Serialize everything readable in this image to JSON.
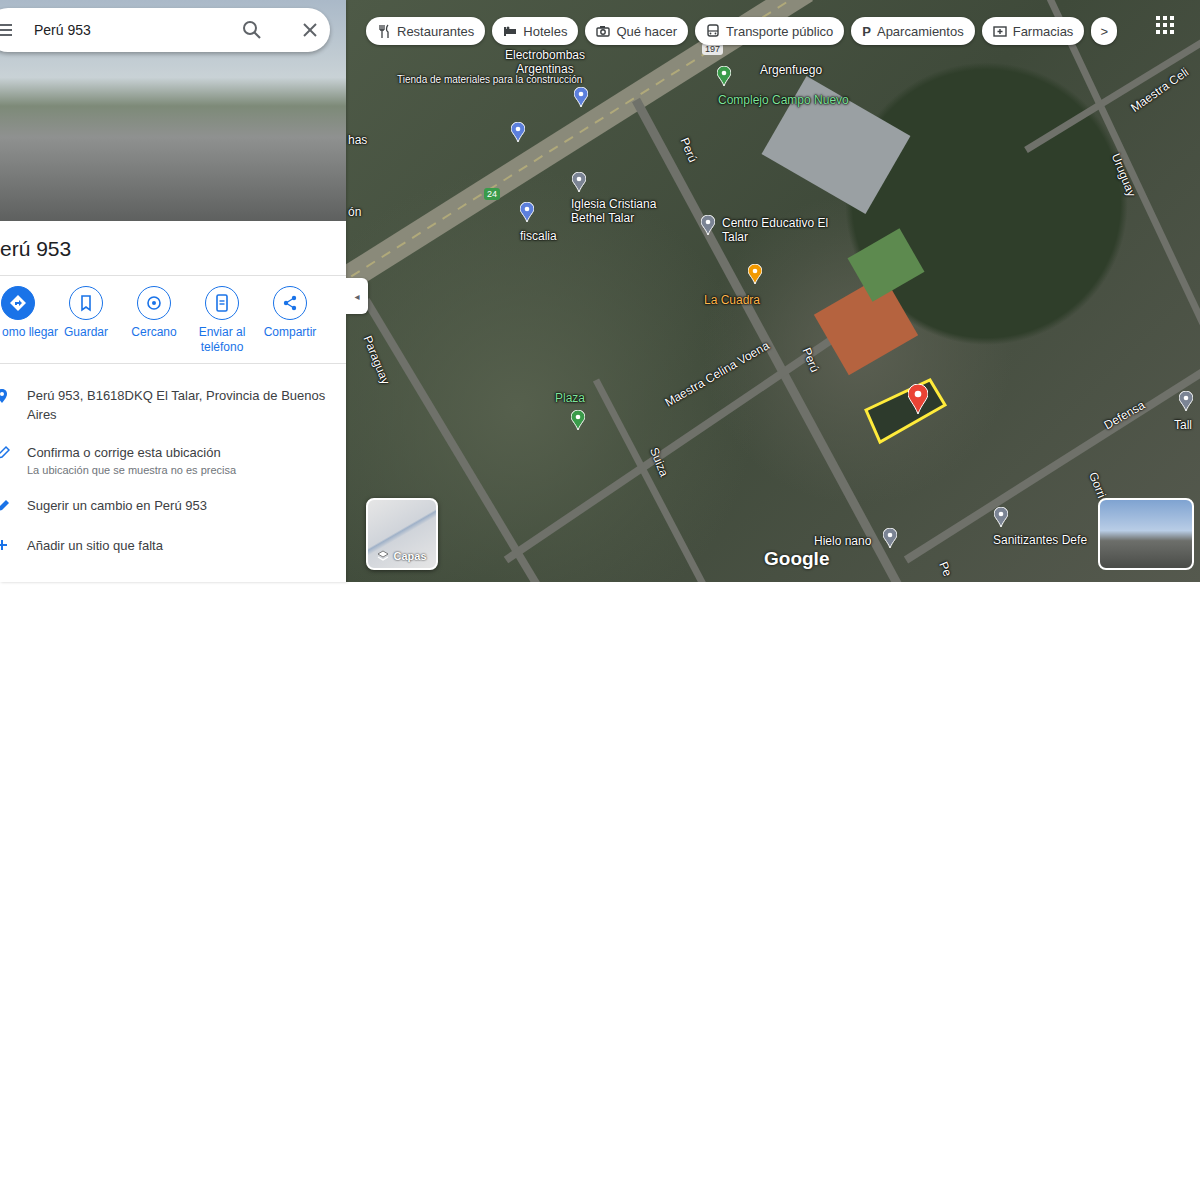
{
  "search": {
    "value": "Perú 953"
  },
  "place": {
    "title": "erú 953"
  },
  "actions": [
    {
      "label": "omo llegar",
      "kind": "directions"
    },
    {
      "label": "Guardar",
      "kind": "save"
    },
    {
      "label": "Cercano",
      "kind": "nearby"
    },
    {
      "label": "Enviar al teléfono",
      "kind": "send"
    },
    {
      "label": "Compartir",
      "kind": "share"
    }
  ],
  "details": [
    {
      "text": "Perú 953, B1618DKQ El Talar, Provincia de Buenos Aires",
      "kind": "address"
    },
    {
      "text": "Confirma o corrige esta ubicación",
      "note": "La ubicación que se muestra no es precisa",
      "kind": "edit"
    },
    {
      "text": "Sugerir un cambio en Perú 953",
      "kind": "suggest"
    },
    {
      "text": "Añadir un sitio que falta",
      "kind": "add"
    }
  ],
  "chips": [
    {
      "label": "Restaurantes",
      "kind": "restaurant"
    },
    {
      "label": "Hoteles",
      "kind": "hotel"
    },
    {
      "label": "Qué hacer",
      "kind": "sights"
    },
    {
      "label": "Transporte público",
      "kind": "transit"
    },
    {
      "label": "Aparcamientos",
      "kind": "parking",
      "glyph": "P"
    },
    {
      "label": "Farmacias",
      "kind": "pharmacy"
    }
  ],
  "chip_more": ">",
  "collapse": "◂",
  "map": {
    "labels": [
      {
        "text": "Electrobombas Argentinas",
        "kind": "poi"
      },
      {
        "text": "Tienda de materiales para la construcción",
        "kind": "small"
      },
      {
        "text": "Argenfuego",
        "kind": "poi"
      },
      {
        "text": "Complejo Campo Nuevo",
        "kind": "park"
      },
      {
        "text": "Iglesia Cristiana Bethel Talar",
        "kind": "poi"
      },
      {
        "text": "fiscalia",
        "kind": "poi"
      },
      {
        "text": "Centro Educativo El Talar",
        "kind": "poi"
      },
      {
        "text": "La Cuadra",
        "kind": "food"
      },
      {
        "text": "Plaza",
        "kind": "park"
      },
      {
        "text": "Maestra Celina Voena",
        "kind": "road"
      },
      {
        "text": "Perú",
        "kind": "road"
      },
      {
        "text": "Perú",
        "kind": "road"
      },
      {
        "text": "Suiza",
        "kind": "road"
      },
      {
        "text": "Paraguay",
        "kind": "road"
      },
      {
        "text": "Uruguay",
        "kind": "road"
      },
      {
        "text": "Maestra Celi",
        "kind": "road"
      },
      {
        "text": "Defensa",
        "kind": "road"
      },
      {
        "text": "Gorri",
        "kind": "road"
      },
      {
        "text": "Hielo nano",
        "kind": "poi"
      },
      {
        "text": "Sanitizantes Defe",
        "kind": "poi"
      },
      {
        "text": "Tall",
        "kind": "poi"
      },
      {
        "text": "24",
        "kind": "badge-green"
      },
      {
        "text": "197",
        "kind": "badge-gray"
      },
      {
        "text": "ón",
        "kind": "poi"
      },
      {
        "text": "has",
        "kind": "poi"
      },
      {
        "text": "Pe",
        "kind": "road"
      }
    ],
    "layers": "Capas",
    "logo": "Google"
  }
}
